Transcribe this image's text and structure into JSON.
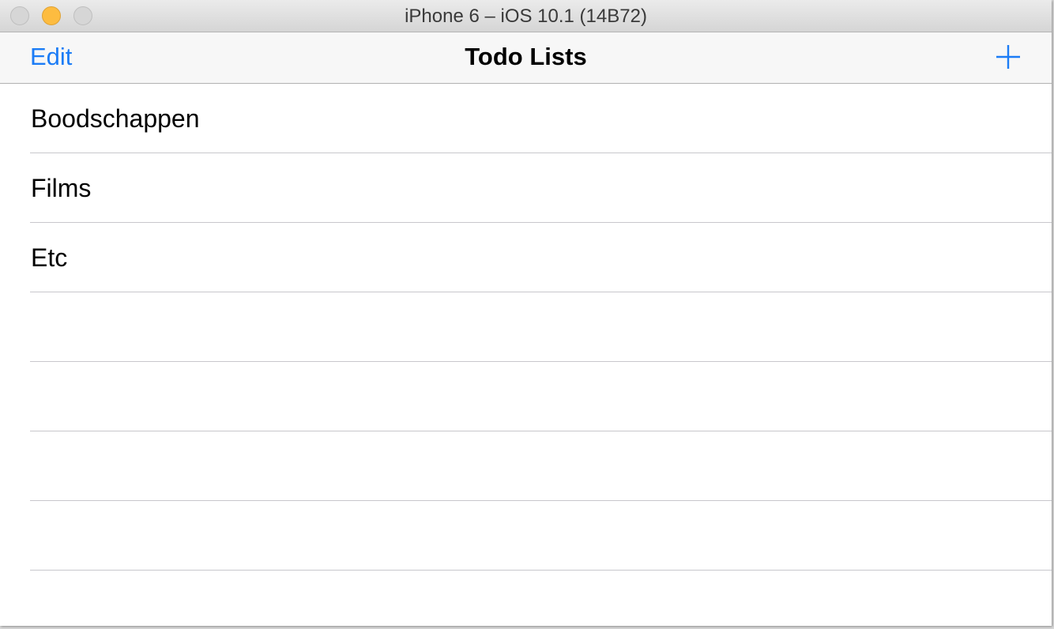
{
  "window": {
    "title": "iPhone 6 – iOS 10.1 (14B72)"
  },
  "navbar": {
    "edit_label": "Edit",
    "title": "Todo Lists",
    "add_icon": "plus-icon"
  },
  "colors": {
    "accent": "#1b7cf6",
    "minimize": "#fdbc40"
  },
  "list": {
    "items": [
      {
        "label": "Boodschappen"
      },
      {
        "label": "Films"
      },
      {
        "label": "Etc"
      },
      {
        "label": ""
      },
      {
        "label": ""
      },
      {
        "label": ""
      },
      {
        "label": ""
      }
    ]
  }
}
